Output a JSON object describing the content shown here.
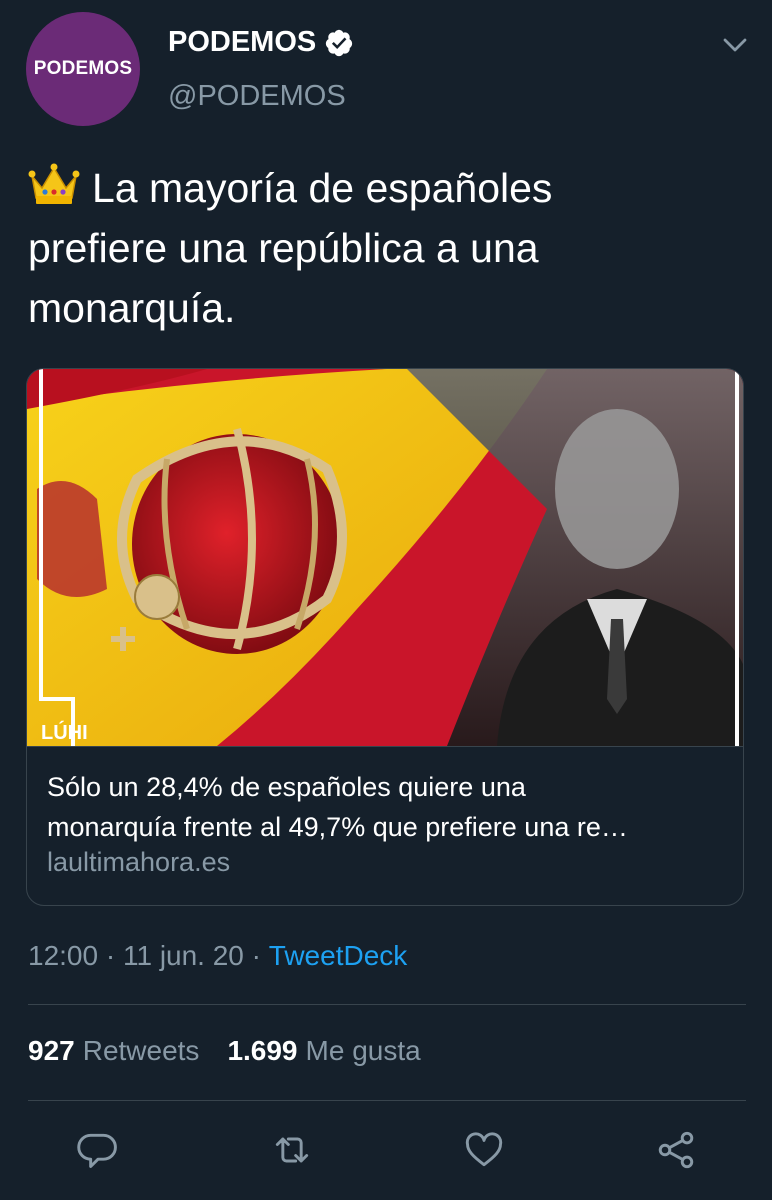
{
  "account": {
    "avatar_text": "PODEMOS",
    "display_name": "PODEMOS",
    "handle": "@PODEMOS",
    "verified": true
  },
  "tweet": {
    "emoji": "crown",
    "text_line1": "La mayoría de españoles",
    "text_line2": "prefiere una república a una",
    "text_line3": "monarquía."
  },
  "card": {
    "image_watermark": "LÚHI",
    "title_line1": "Sólo un 28,4% de españoles quiere una",
    "title_line2": "monarquía frente al 49,7% que prefiere una re…",
    "domain": "laultimahora.es"
  },
  "meta": {
    "time": "12:00",
    "sep1": " · ",
    "date": "11 jun. 20",
    "sep2": " · ",
    "source": "TweetDeck"
  },
  "stats": {
    "retweets_count": "927",
    "retweets_label": "Retweets",
    "likes_count": "1.699",
    "likes_label": "Me gusta"
  },
  "colors": {
    "background": "#15202b",
    "secondary_text": "#8899a6",
    "link": "#1da1f2",
    "avatar": "#6b2b77",
    "border": "#38444d"
  },
  "icons": [
    "verified-badge-icon",
    "chevron-down-icon",
    "reply-icon",
    "retweet-icon",
    "like-icon",
    "share-icon"
  ]
}
